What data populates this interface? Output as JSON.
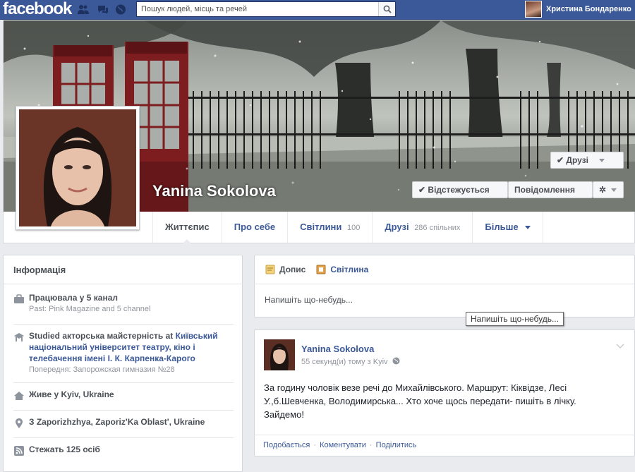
{
  "topbar": {
    "logo": "facebook",
    "search_placeholder": "Пошук людей, місць та речей",
    "user_name": "Христина Бондаренко"
  },
  "profile": {
    "name": "Yanina Sokolova",
    "buttons": {
      "friends": "Друзі",
      "following": "Відстежується",
      "message": "Повідомлення"
    },
    "tabs": [
      {
        "label": "Життєпис",
        "count": ""
      },
      {
        "label": "Про себе",
        "count": ""
      },
      {
        "label": "Світлини",
        "count": "100"
      },
      {
        "label": "Друзі",
        "count": "286 спільних"
      },
      {
        "label": "Більше",
        "count": ""
      }
    ]
  },
  "info": {
    "title": "Інформація",
    "rows": [
      {
        "text": "Працювала у 5 канал",
        "sub": "Past: Pink Magazine and 5 channel"
      },
      {
        "text_pre": "Studied акторська майстерність at ",
        "text_link": "Київський національний університет театру, кіно і телебачення імені І. К. Карпенка-Карого",
        "sub": "Попередня: Запорожская гимназия №28"
      },
      {
        "text": "Живе у Kyiv, Ukraine"
      },
      {
        "text": "З Zaporizhzhya, Zaporiz'Ka Oblast', Ukraine"
      },
      {
        "text": "Стежать 125 осіб"
      }
    ]
  },
  "composer": {
    "tabs": [
      "Допис",
      "Світлина"
    ],
    "placeholder": "Напишіть що-небудь...",
    "tooltip": "Напишіть що-небудь..."
  },
  "post": {
    "author": "Yanina Sokolova",
    "meta": "55 секунд(и) тому з Kyiv",
    "text": "За годину чоловік везе речі до Михайлівського. Маршрут: Кіквідзе, Лесі У.,б.Шевченка, Володимирська... Хто хоче щось передати- пишіть в лічку. Зайдемо!",
    "actions": [
      "Подобається",
      "Коментувати",
      "Поділитись"
    ],
    "action_sep": "·"
  },
  "colors": {
    "brand": "#3b5998",
    "background": "#e9ebee",
    "link": "#3b5998"
  }
}
